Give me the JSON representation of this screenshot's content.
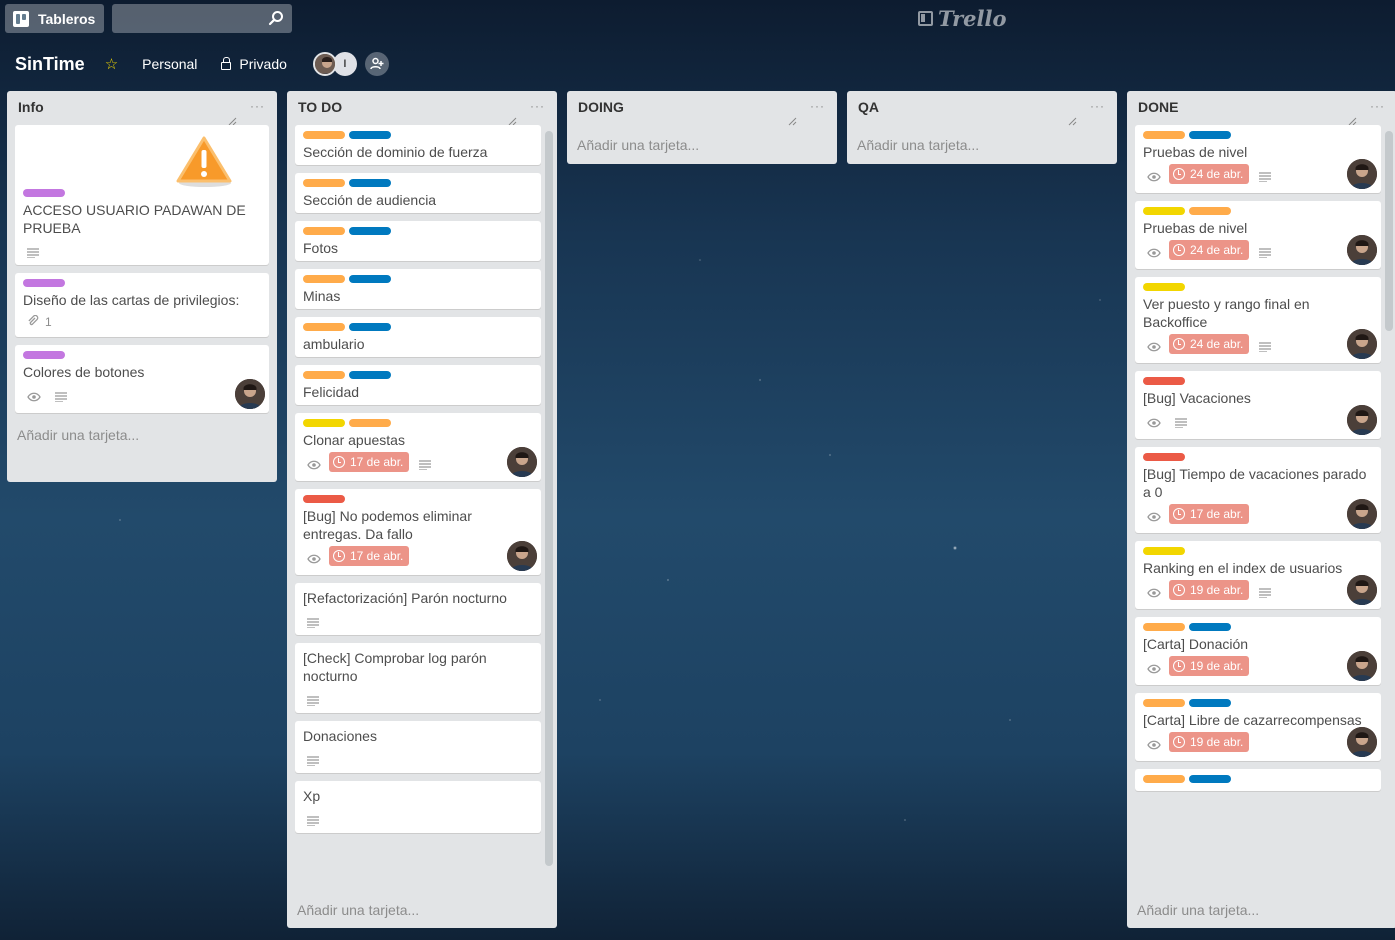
{
  "topbar": {
    "boards_label": "Tableros",
    "search_placeholder": "",
    "logo_text": "Trello"
  },
  "board": {
    "title": "SinTime",
    "team": "Personal",
    "visibility": "Privado",
    "member_initial": "I"
  },
  "add_card_label": "Añadir una tarjeta...",
  "lists": [
    {
      "title": "Info",
      "cards": [
        {
          "cover": "warning-icon",
          "labels": [
            "purple"
          ],
          "title": "ACCESO USUARIO PADAWAN DE PRUEBA",
          "desc": true
        },
        {
          "labels": [
            "purple"
          ],
          "title": "Diseño de las cartas de privilegios:",
          "attachments": "1"
        },
        {
          "labels": [
            "purple"
          ],
          "title": "Colores de botones",
          "watch": true,
          "desc": true,
          "member": true
        }
      ]
    },
    {
      "title": "TO DO",
      "cards": [
        {
          "labels": [
            "orange",
            "blue"
          ],
          "title": "Sección de dominio de fuerza"
        },
        {
          "labels": [
            "orange",
            "blue"
          ],
          "title": "Sección de audiencia"
        },
        {
          "labels": [
            "orange",
            "blue"
          ],
          "title": "Fotos"
        },
        {
          "labels": [
            "orange",
            "blue"
          ],
          "title": "Minas"
        },
        {
          "labels": [
            "orange",
            "blue"
          ],
          "title": "ambulario"
        },
        {
          "labels": [
            "orange",
            "blue"
          ],
          "title": "Felicidad"
        },
        {
          "labels": [
            "yellow",
            "orange"
          ],
          "title": "Clonar apuestas",
          "watch": true,
          "due": "17 de abr.",
          "desc": true,
          "member": true
        },
        {
          "labels": [
            "red"
          ],
          "title": "[Bug] No podemos eliminar entregas. Da fallo",
          "watch": true,
          "due": "17 de abr.",
          "member": true
        },
        {
          "labels": [],
          "title": "[Refactorización] Parón nocturno",
          "desc": true
        },
        {
          "labels": [],
          "title": "[Check] Comprobar log parón nocturno",
          "desc": true
        },
        {
          "labels": [],
          "title": "Donaciones",
          "desc": true
        },
        {
          "labels": [],
          "title": "Xp",
          "desc": true
        }
      ]
    },
    {
      "title": "DOING",
      "cards": []
    },
    {
      "title": "QA",
      "cards": []
    },
    {
      "title": "DONE",
      "cards": [
        {
          "labels": [
            "orange",
            "blue"
          ],
          "title": "Pruebas de nivel",
          "watch": true,
          "due": "24 de abr.",
          "desc": true,
          "member": true
        },
        {
          "labels": [
            "yellow",
            "orange"
          ],
          "title": "Pruebas de nivel",
          "watch": true,
          "due": "24 de abr.",
          "desc": true,
          "member": true
        },
        {
          "labels": [
            "yellow"
          ],
          "title": "Ver puesto y rango final en Backoffice",
          "watch": true,
          "due": "24 de abr.",
          "desc": true,
          "member": true
        },
        {
          "labels": [
            "red"
          ],
          "title": "[Bug] Vacaciones",
          "watch": true,
          "desc": true,
          "member": true
        },
        {
          "labels": [
            "red"
          ],
          "title": "[Bug] Tiempo de vacaciones parado a 0",
          "watch": true,
          "due": "17 de abr.",
          "member": true
        },
        {
          "labels": [
            "yellow"
          ],
          "title": "Ranking en el index de usuarios",
          "watch": true,
          "due": "19 de abr.",
          "desc": true,
          "member": true
        },
        {
          "labels": [
            "orange",
            "blue"
          ],
          "title": "[Carta] Donación",
          "watch": true,
          "due": "19 de abr.",
          "member": true
        },
        {
          "labels": [
            "orange",
            "blue"
          ],
          "title": "[Carta] Libre de cazarrecompensas",
          "watch": true,
          "due": "19 de abr.",
          "member": true
        },
        {
          "labels": [
            "orange",
            "blue"
          ],
          "title": ""
        }
      ]
    }
  ]
}
